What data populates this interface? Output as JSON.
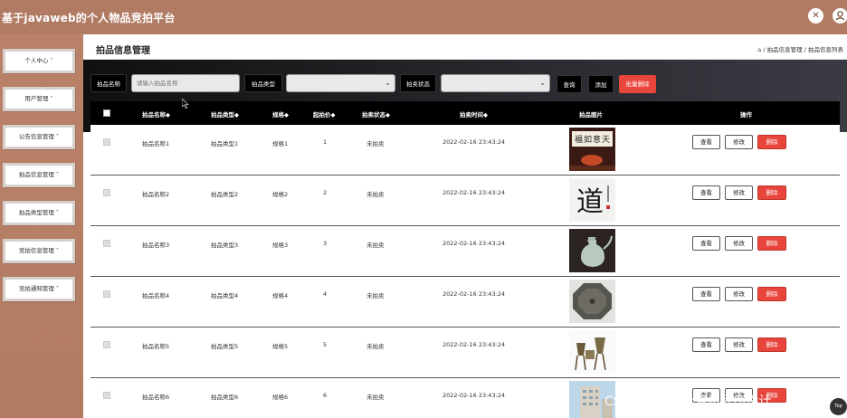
{
  "app": {
    "title": "基于javaweb的个人物品竞拍平台"
  },
  "header_icons": [
    "tools-icon",
    "user-icon"
  ],
  "sidebar": {
    "items": [
      {
        "label": "个人中心 ˅"
      },
      {
        "label": "用户管理 ˅"
      },
      {
        "label": "公告信息管理 ˅"
      },
      {
        "label": "拍品信息管理 ˅"
      },
      {
        "label": "拍品类型管理 ˅"
      },
      {
        "label": "竞拍信息管理 ˅"
      },
      {
        "label": "竞拍通知管理 ˅"
      }
    ]
  },
  "page": {
    "title": "拍品信息管理",
    "breadcrumb": "⌂ / 拍品信息管理 / 拍品信息列表"
  },
  "search": {
    "name_label": "拍品名称",
    "name_placeholder": "请输入拍品名称",
    "type_label": "拍品类型",
    "status_label": "拍卖状态",
    "query_button": "查询",
    "add_button": "添加",
    "batch_delete_button": "批量删除"
  },
  "table": {
    "headers": {
      "name": "拍品名称◆",
      "type": "拍品类型◆",
      "spec": "规格◆",
      "start_price": "起拍价◆",
      "status": "拍卖状态◆",
      "time": "拍卖时间◆",
      "image": "拍品图片",
      "actions": "操作"
    },
    "rows": [
      {
        "name": "拍品名称1",
        "type": "拍品类型1",
        "spec": "规格1",
        "price": "1",
        "status": "未拍卖",
        "time": "2022-02-16 23:43:24",
        "view": "查看",
        "edit": "修改",
        "delete": "删除"
      },
      {
        "name": "拍品名称2",
        "type": "拍品类型2",
        "spec": "规格2",
        "price": "2",
        "status": "未拍卖",
        "time": "2022-02-16 23:43:24",
        "view": "查看",
        "edit": "修改",
        "delete": "删除"
      },
      {
        "name": "拍品名称3",
        "type": "拍品类型3",
        "spec": "规格3",
        "price": "3",
        "status": "未拍卖",
        "time": "2022-02-16 23:43:24",
        "view": "查看",
        "edit": "修改",
        "delete": "删除"
      },
      {
        "name": "拍品名称4",
        "type": "拍品类型4",
        "spec": "规格4",
        "price": "4",
        "status": "未拍卖",
        "time": "2022-02-16 23:43:24",
        "view": "查看",
        "edit": "修改",
        "delete": "删除"
      },
      {
        "name": "拍品名称5",
        "type": "拍品类型5",
        "spec": "规格5",
        "price": "5",
        "status": "未拍卖",
        "time": "2022-02-16 23:43:24",
        "view": "查看",
        "edit": "修改",
        "delete": "删除"
      },
      {
        "name": "拍品名称6",
        "type": "拍品类型6",
        "spec": "规格6",
        "price": "6",
        "status": "未拍卖",
        "time": "2022-02-16 23:43:24",
        "view": "查看",
        "edit": "修改",
        "delete": "删除"
      }
    ]
  },
  "overlay": {
    "watermark": "CSDN @芹心计算机程序设计",
    "top_button": "Top"
  },
  "colors": {
    "header_bg": "#b07a63",
    "sidebar_bg": "#b27c63",
    "table_header_bg": "#000000",
    "delete_red": "#e8453c"
  }
}
